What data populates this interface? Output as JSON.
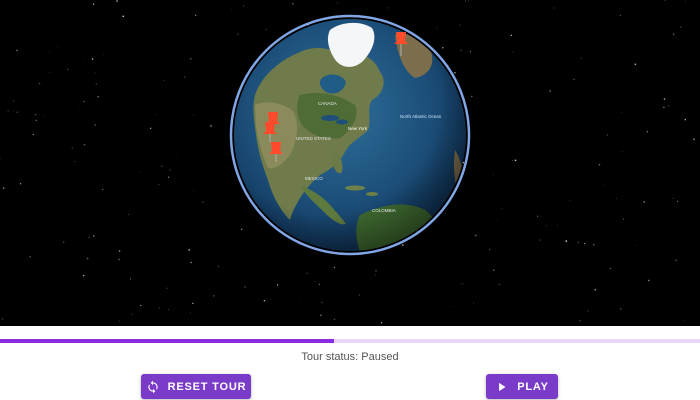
{
  "viewer": {
    "label": "globe-viewport"
  },
  "progress": {
    "fraction": 0.477,
    "fill_color": "#8a2be2",
    "track_color": "#ead5f7"
  },
  "status": {
    "text": "Tour status: Paused"
  },
  "controls": {
    "reset_label": "RESET TOUR",
    "reset_icon": "refresh-icon",
    "play_label": "PLAY",
    "play_icon": "play-icon",
    "button_color": "#7a3bc9"
  },
  "map_labels": {
    "canada": "CANADA",
    "united_states": "UNITED STATES",
    "mexico": "MEXICO",
    "north_atlantic": "North Atlantic Ocean",
    "new_york": "New York",
    "colombia": "COLOMBIA"
  },
  "pins": [
    {
      "name": "pin-greenland"
    },
    {
      "name": "pin-seattle"
    },
    {
      "name": "pin-san-francisco"
    },
    {
      "name": "pin-los-angeles"
    }
  ]
}
